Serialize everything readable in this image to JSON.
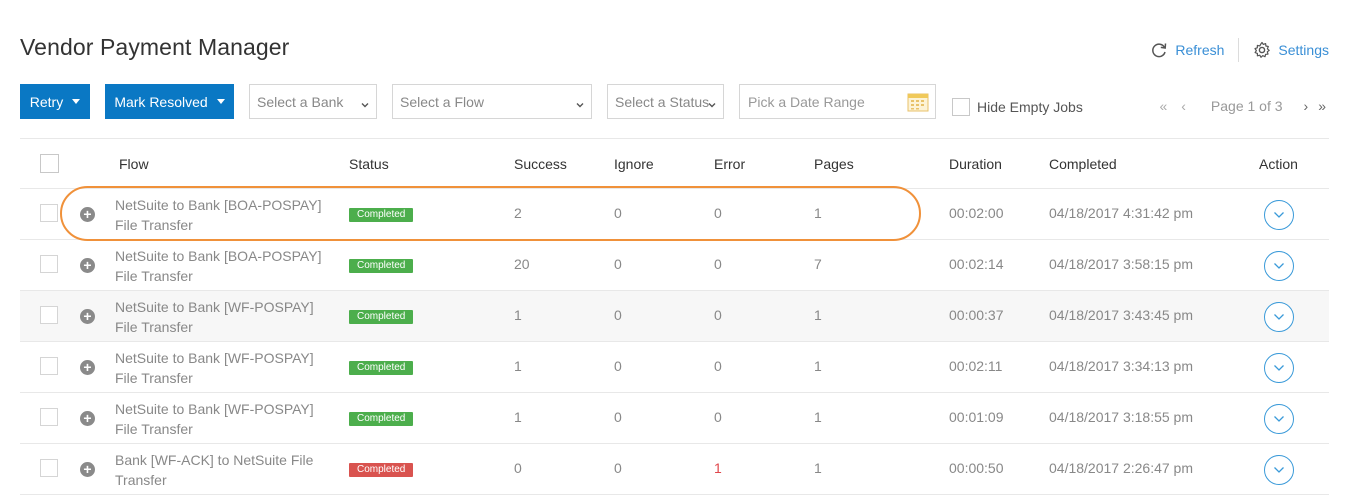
{
  "page": {
    "title": "Vendor Payment Manager"
  },
  "top_actions": {
    "refresh_label": "Refresh",
    "settings_label": "Settings"
  },
  "toolbar": {
    "retry_label": "Retry",
    "mark_resolved_label": "Mark Resolved",
    "bank_select": "Select a Bank",
    "flow_select": "Select a Flow",
    "status_select": "Select a Status",
    "date_placeholder": "Pick a Date Range",
    "hide_empty_label": "Hide Empty Jobs"
  },
  "pager": {
    "first": "«",
    "prev": "‹",
    "info": "Page 1 of 3",
    "next": "›",
    "last": "»"
  },
  "table": {
    "columns": {
      "flow": "Flow",
      "status": "Status",
      "success": "Success",
      "ignore": "Ignore",
      "error": "Error",
      "pages": "Pages",
      "duration": "Duration",
      "completed": "Completed",
      "action": "Action"
    },
    "rows": [
      {
        "flow": "NetSuite to Bank [BOA-POSPAY] File Transfer",
        "status": "Completed",
        "status_color": "#4cae4c",
        "success": "2",
        "ignore": "0",
        "error": "0",
        "pages": "1",
        "duration": "00:02:00",
        "completed": "04/18/2017 4:31:42 pm"
      },
      {
        "flow": "NetSuite to Bank [BOA-POSPAY] File Transfer",
        "status": "Completed",
        "status_color": "#4cae4c",
        "success": "20",
        "ignore": "0",
        "error": "0",
        "pages": "7",
        "duration": "00:02:14",
        "completed": "04/18/2017 3:58:15 pm"
      },
      {
        "flow": "NetSuite to Bank [WF-POSPAY] File Transfer",
        "status": "Completed",
        "status_color": "#4cae4c",
        "success": "1",
        "ignore": "0",
        "error": "0",
        "pages": "1",
        "duration": "00:00:37",
        "completed": "04/18/2017 3:43:45 pm"
      },
      {
        "flow": "NetSuite to Bank [WF-POSPAY] File Transfer",
        "status": "Completed",
        "status_color": "#4cae4c",
        "success": "1",
        "ignore": "0",
        "error": "0",
        "pages": "1",
        "duration": "00:02:11",
        "completed": "04/18/2017 3:34:13 pm"
      },
      {
        "flow": "NetSuite to Bank [WF-POSPAY] File Transfer",
        "status": "Completed",
        "status_color": "#4cae4c",
        "success": "1",
        "ignore": "0",
        "error": "0",
        "pages": "1",
        "duration": "00:01:09",
        "completed": "04/18/2017 3:18:55 pm"
      },
      {
        "flow": "Bank [WF-ACK] to NetSuite File Transfer",
        "status": "Completed",
        "status_color": "#d9534f",
        "success": "0",
        "ignore": "0",
        "error": "1",
        "error_color": "#e0474c",
        "pages": "1",
        "duration": "00:00:50",
        "completed": "04/18/2017 2:26:47 pm"
      }
    ]
  },
  "colors": {
    "accent": "#0a78c4",
    "link": "#3a8fd6",
    "highlight": "#f0913a"
  }
}
